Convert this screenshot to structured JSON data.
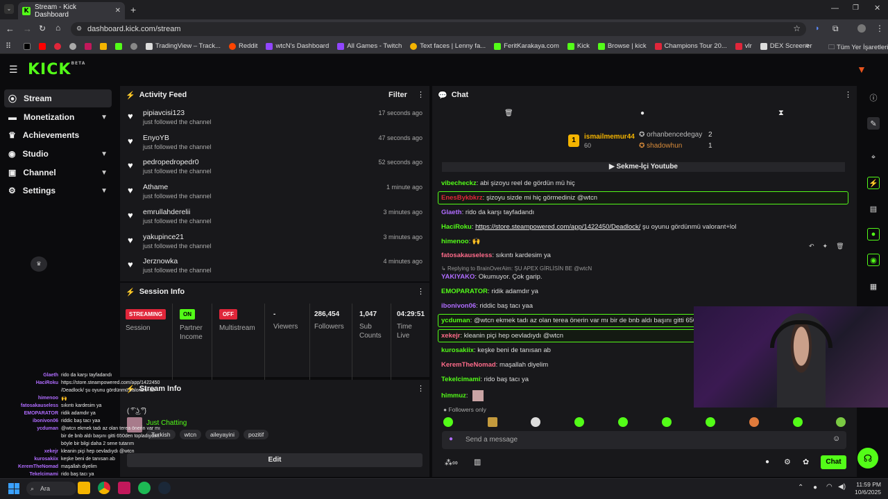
{
  "browser": {
    "tab_title": "Stream - Kick Dashboard",
    "url": "dashboard.kick.com/stream",
    "bookmarks": [
      "TradingView – Track...",
      "Reddit",
      "wtcN's Dashboard",
      "All Games - Twitch",
      "Text faces | Lenny fa...",
      "FeritKarakaya.com",
      "Kick",
      "Browse | kick",
      "Champions Tour 20...",
      "vlr",
      "DEX Screener"
    ],
    "all_bookmarks": "Tüm Yer İşaretleri"
  },
  "kick": {
    "logo": "KICK",
    "beta": "BETA"
  },
  "sidebar": {
    "items": [
      {
        "label": "Stream",
        "icon": "radio-icon",
        "chevron": false,
        "active": true
      },
      {
        "label": "Monetization",
        "icon": "money-icon",
        "chevron": true
      },
      {
        "label": "Achievements",
        "icon": "trophy-icon",
        "chevron": false
      },
      {
        "label": "Studio",
        "icon": "studio-icon",
        "chevron": true
      },
      {
        "label": "Channel",
        "icon": "channel-icon",
        "chevron": true
      },
      {
        "label": "Settings",
        "icon": "gear-icon",
        "chevron": true
      }
    ]
  },
  "activity": {
    "title": "Activity Feed",
    "filter": "Filter",
    "items": [
      {
        "name": "pipiavcisi123",
        "sub": "just followed the channel",
        "time": "17 seconds ago"
      },
      {
        "name": "EnyoYB",
        "sub": "just followed the channel",
        "time": "47 seconds ago"
      },
      {
        "name": "pedropedropedr0",
        "sub": "just followed the channel",
        "time": "52 seconds ago"
      },
      {
        "name": "Athame",
        "sub": "just followed the channel",
        "time": "1 minute ago"
      },
      {
        "name": "emrullahderelii",
        "sub": "just followed the channel",
        "time": "3 minutes ago"
      },
      {
        "name": "yakupince21",
        "sub": "just followed the channel",
        "time": "3 minutes ago"
      },
      {
        "name": "Jerznowka",
        "sub": "just followed the channel",
        "time": "4 minutes ago"
      }
    ]
  },
  "session": {
    "title": "Session Info",
    "cells": [
      {
        "badge": "STREAMING",
        "badge_color": "#e0263a",
        "label": "Session"
      },
      {
        "badge": "ON",
        "badge_color": "#53fc18",
        "label": "Partner Income"
      },
      {
        "badge": "OFF",
        "badge_color": "#e0263a",
        "label": "Multistream"
      },
      {
        "value": "-",
        "label": "Viewers"
      },
      {
        "value": "286,454",
        "label": "Followers"
      },
      {
        "value": "1,047",
        "label": "Sub Counts"
      },
      {
        "value": "04:29:51",
        "label": "Time Live"
      }
    ]
  },
  "stream_info": {
    "title": "Stream Info",
    "stream_title": "( ͡° ͜ʖ ͡°)",
    "category": "Just Chatting",
    "tags": [
      "Turkish",
      "wtcn",
      "aileyayini",
      "pozitif"
    ],
    "edit": "Edit"
  },
  "chat": {
    "title": "Chat",
    "top": [
      {
        "rank": "1",
        "name": "ismailmemur44",
        "value": "60"
      },
      {
        "rank": "2",
        "name": "orhanbencedegay",
        "value": "2"
      },
      {
        "rank": "3",
        "name": "shadowhun",
        "value": "1"
      }
    ],
    "pinned": "Sekme-İçi Youtube",
    "messages": [
      {
        "user": "vibecheckz",
        "color": "#53fc18",
        "text": "abi şizoyu reel de gördün mü hiç"
      },
      {
        "user": "EnesBykbkrz",
        "color": "#e0263a",
        "text": "şizoyu sizde mi hiç görmediniz @wtcn",
        "hl": true
      },
      {
        "user": "Glaeth",
        "color": "#b06cff",
        "text": "rido da karşı tayfadandı"
      },
      {
        "user": "HaciRoku",
        "color": "#53fc18",
        "text": "https://store.steampowered.com/app/1422450/Deadlock/",
        "text2": " şu oyunu gördünmü valorant+lol"
      },
      {
        "user": "himenoo",
        "color": "#53fc18",
        "text": "🙌"
      },
      {
        "user": "fatosakauseless",
        "color": "#ff6b8a",
        "text": "sıkıntı kardesim ya"
      },
      {
        "reply": "Replying to BrainOverAim: ŞU APEX GİRLİSİN BE @wtcN"
      },
      {
        "user": "YAKIYAKO",
        "color": "#b06cff",
        "text": "Okumuyor. Çok garip."
      },
      {
        "user": "EMOPARATOR",
        "color": "#53fc18",
        "text": "ridik adamdır ya"
      },
      {
        "user": "ibonivon06",
        "color": "#b06cff",
        "text": "riddic baş tacı yaa"
      },
      {
        "user": "ycduman",
        "color": "#53fc18",
        "text": "@wtcn ekmek tadı az olan terea önerin var mı bir de bnb aldı başını gitti 650de",
        "hl": true
      },
      {
        "user": "xekejr",
        "color": "#ff6b8a",
        "text": "kleanin piçi hep oevladıydı @wtcn",
        "hl": true
      },
      {
        "user": "kurosakiix",
        "color": "#53fc18",
        "text": "keşke beni de tanısan ab"
      },
      {
        "user": "KeremTheNomad",
        "color": "#ff6b8a",
        "text": "maşallah diyelim"
      },
      {
        "user": "Tekelcimami",
        "color": "#53fc18",
        "text": "rido baş tacı ya"
      },
      {
        "user": "himmuz",
        "color": "#53fc18",
        "text": ""
      }
    ],
    "followers_only": "Followers only",
    "input_placeholder": "Send a message",
    "send": "Chat"
  },
  "overlay": {
    "lines": [
      {
        "u": "Glaeth",
        "t": "rido da karşı tayfadandı"
      },
      {
        "u": "HaciRoku",
        "t": "https://store.steampowered.com/app/1422450"
      },
      {
        "u": "",
        "t": "/Deadlock/ şu oyunu gördünmü valorant+lol"
      },
      {
        "u": "himenoo",
        "t": "🙌"
      },
      {
        "u": "fatosakauseless",
        "t": "sıkıntı kardesim ya"
      },
      {
        "u": "EMOPARATOR",
        "t": "ridik adamdır ya"
      },
      {
        "u": "ibonivon06",
        "t": "riddic baş tacı yaa"
      },
      {
        "u": "ycduman",
        "t": "@wtcn ekmek tadı az olan terea önerin var mı"
      },
      {
        "u": "",
        "t": "bir de bnb aldı başını gitti 650den topladıydım"
      },
      {
        "u": "",
        "t": "böyle bir bilgi daha 2 sene tutarım"
      },
      {
        "u": "xekejr",
        "t": "kleanin piçi hep oevladıydı @wtcn"
      },
      {
        "u": "kurosakiix",
        "t": "keşke beni de tanısan ab"
      },
      {
        "u": "KeremTheNomad",
        "t": "maşallah diyelim"
      },
      {
        "u": "Tekelcimami",
        "t": "rido baş tacı ya"
      },
      {
        "u": "himmuz",
        "t": ""
      }
    ]
  },
  "taskbar": {
    "search": "Ara",
    "time": "11:59 PM",
    "date": "10/6/2025"
  }
}
